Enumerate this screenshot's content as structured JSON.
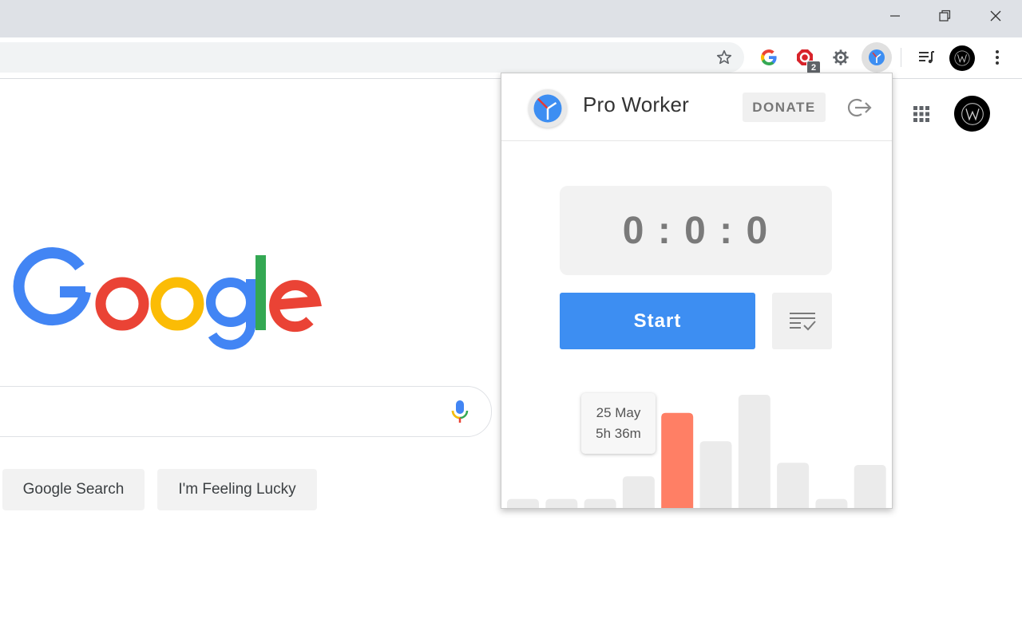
{
  "browser": {
    "window_controls": [
      "minimize-icon",
      "restore-icon",
      "close-icon"
    ],
    "extension_badge": "2"
  },
  "google": {
    "search_button": "Google Search",
    "lucky_button": "I'm Feeling Lucky"
  },
  "popup": {
    "title": "Pro Worker",
    "donate": "DONATE",
    "timer": "0 : 0 : 0",
    "start": "Start",
    "tooltip": {
      "date": "25 May",
      "duration": "5h 36m"
    }
  },
  "colors": {
    "accent": "#3d8ef2",
    "highlight_bar": "#ff7f65",
    "bar": "#ebebeb"
  },
  "chart_data": {
    "type": "bar",
    "values": [
      0.08,
      0.08,
      0.08,
      0.28,
      0.84,
      0.59,
      1.0,
      0.4,
      0.08,
      0.38
    ],
    "highlight_index": 4
  }
}
